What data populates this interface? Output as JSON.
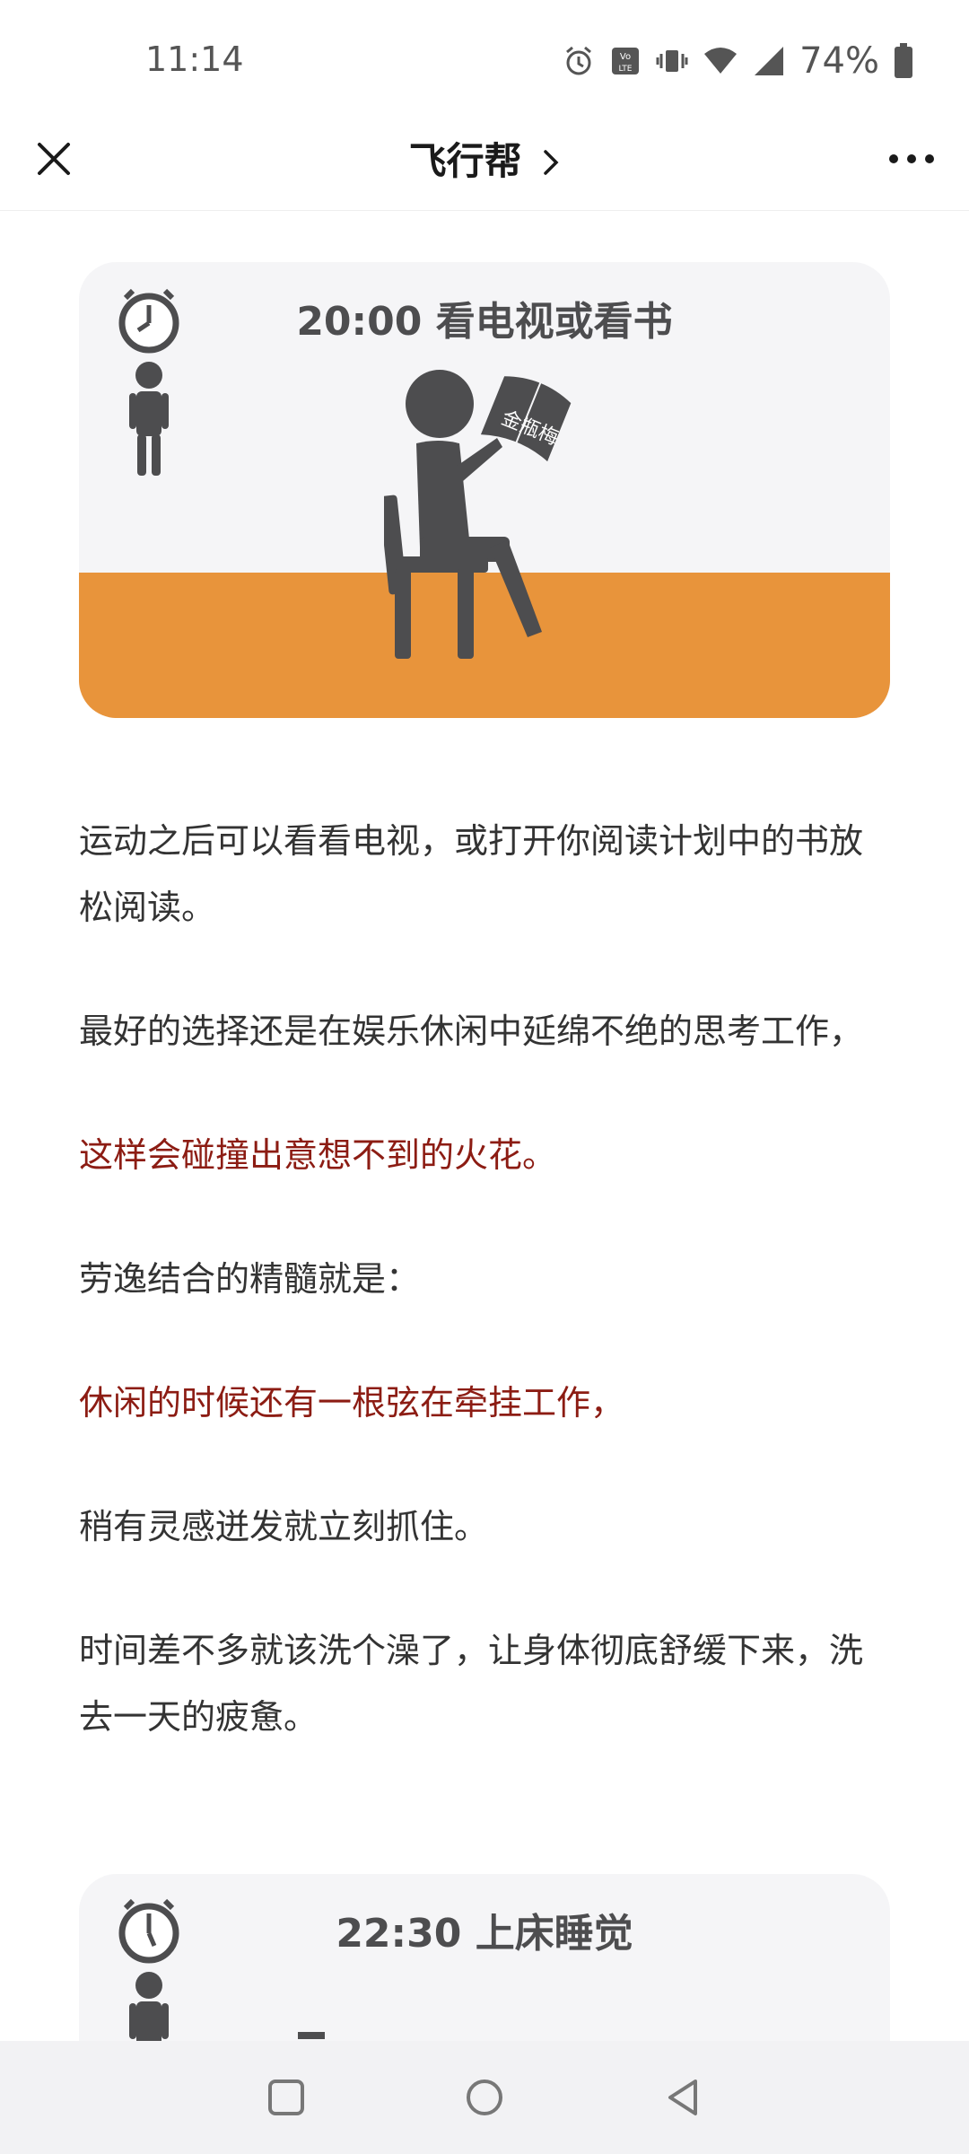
{
  "status_bar": {
    "time": "11:14",
    "battery_percent": "74%",
    "icons": [
      "alarm-icon",
      "volte-icon",
      "vibrate-icon",
      "wifi-icon",
      "signal-icon",
      "battery-icon"
    ]
  },
  "nav": {
    "title": "飞行帮",
    "icons": [
      "close-icon",
      "chevron-right-icon",
      "more-icon"
    ]
  },
  "cards": [
    {
      "heading": "20:00 看电视或看书",
      "book_label": "金瓶梅",
      "colors": {
        "background": "#f5f5f7",
        "ground": "#e8943b",
        "figure": "#4d4d4f"
      }
    },
    {
      "heading": "22:30 上床睡觉"
    }
  ],
  "article": {
    "p1": "运动之后可以看看电视，或打开你阅读计划中的书放松阅读。",
    "p2": "最好的选择还是在娱乐休闲中延绵不绝的思考工作，",
    "p3": "这样会碰撞出意想不到的火花。",
    "p4": "劳逸结合的精髓就是：",
    "p5": "休闲的时候还有一根弦在牵挂工作，",
    "p6": "稍有灵感迸发就立刻抓住。",
    "p7": "时间差不多就该洗个澡了，让身体彻底舒缓下来，洗去一天的疲惫。",
    "highlight_color": "#8c1c13"
  },
  "system_nav": {
    "icons": [
      "recents-square-icon",
      "home-circle-icon",
      "back-triangle-icon"
    ]
  }
}
